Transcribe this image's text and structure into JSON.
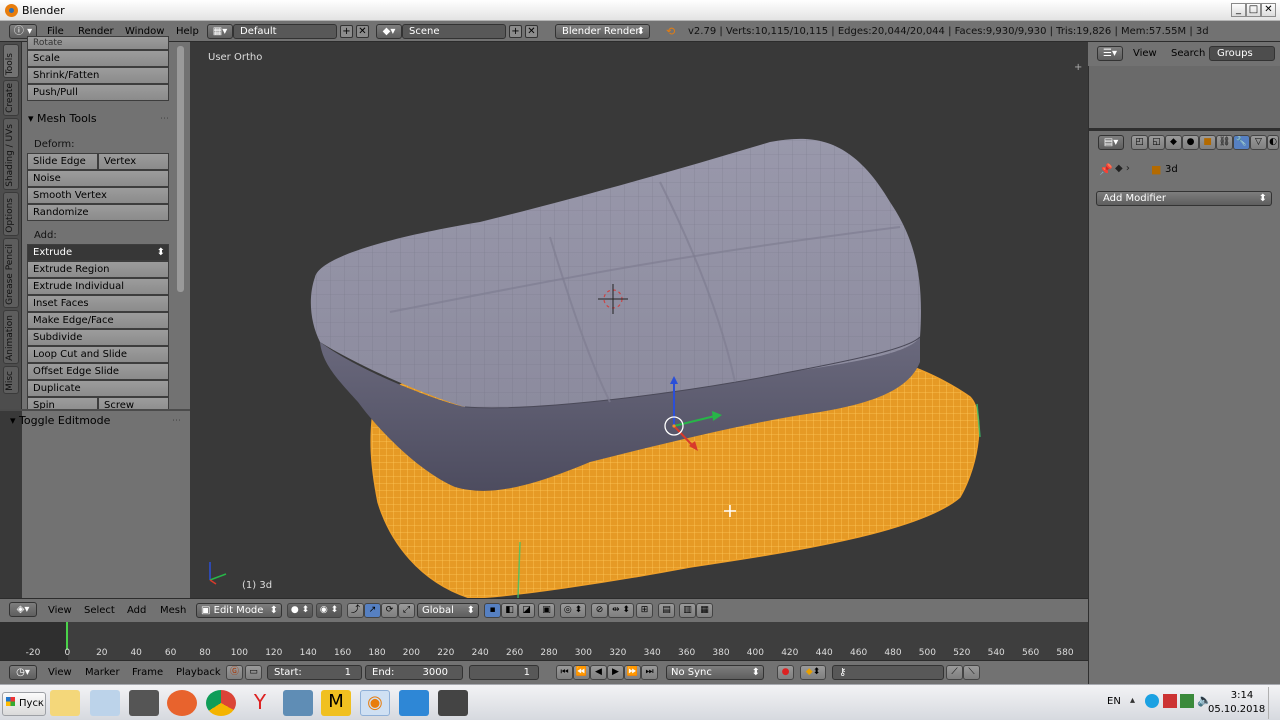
{
  "window": {
    "title": "Blender"
  },
  "info": {
    "menus": [
      "File",
      "Render",
      "Window",
      "Help"
    ],
    "layout": "Default",
    "scene": "Scene",
    "engine": "Blender Render",
    "stats": "v2.79 | Verts:10,115/10,115 | Edges:20,044/20,044 | Faces:9,930/9,930 | Tris:19,826 | Mem:57.55M | 3d"
  },
  "tabs": [
    "Tools",
    "Create",
    "Shading / UVs",
    "Options",
    "Grease Pencil",
    "Animation",
    "Misc"
  ],
  "tools": {
    "top": [
      "Rotate",
      "Scale",
      "Shrink/Fatten",
      "Push/Pull"
    ],
    "mesh_tools_title": "Mesh Tools",
    "deform_label": "Deform:",
    "slide_edge": "Slide Edge",
    "vertex": "Vertex",
    "deform": [
      "Noise",
      "Smooth Vertex",
      "Randomize"
    ],
    "add_label": "Add:",
    "extrude": "Extrude",
    "add": [
      "Extrude Region",
      "Extrude Individual",
      "Inset Faces",
      "Make Edge/Face",
      "Subdivide",
      "Loop Cut and Slide",
      "Offset Edge Slide",
      "Duplicate"
    ],
    "spin": "Spin",
    "screw": "Screw",
    "toggle": "Toggle Editmode"
  },
  "viewport": {
    "view_name": "User Ortho",
    "object_name": "(1) 3d"
  },
  "view_header": {
    "menus": [
      "View",
      "Select",
      "Add",
      "Mesh"
    ],
    "mode": "Edit Mode",
    "orientation": "Global"
  },
  "timeline": {
    "ticks": [
      "-20",
      "0",
      "20",
      "40",
      "60",
      "80",
      "100",
      "120",
      "140",
      "160",
      "180",
      "200",
      "220",
      "240",
      "260",
      "280",
      "300",
      "320",
      "340",
      "360",
      "380",
      "400",
      "420",
      "440",
      "460",
      "480",
      "500",
      "520",
      "540",
      "560",
      "580"
    ],
    "menus": [
      "View",
      "Marker",
      "Frame",
      "Playback"
    ],
    "start_label": "Start:",
    "start": "1",
    "end_label": "End:",
    "end": "3000",
    "current": "1",
    "sync": "No Sync"
  },
  "outliner": {
    "view": "View",
    "search": "Search",
    "groups": "Groups"
  },
  "properties": {
    "object": "3d",
    "add_modifier": "Add Modifier"
  },
  "taskbar": {
    "start": "Пуск",
    "lang": "EN",
    "time": "3:14",
    "date": "05.10.2018"
  },
  "colors": {
    "viewport_bg": "#393939",
    "panel": "#727272",
    "mesh_selected": "#f0a12a",
    "mesh_grey": "#7b7a8c",
    "frame_cursor": "#4ad34a"
  }
}
